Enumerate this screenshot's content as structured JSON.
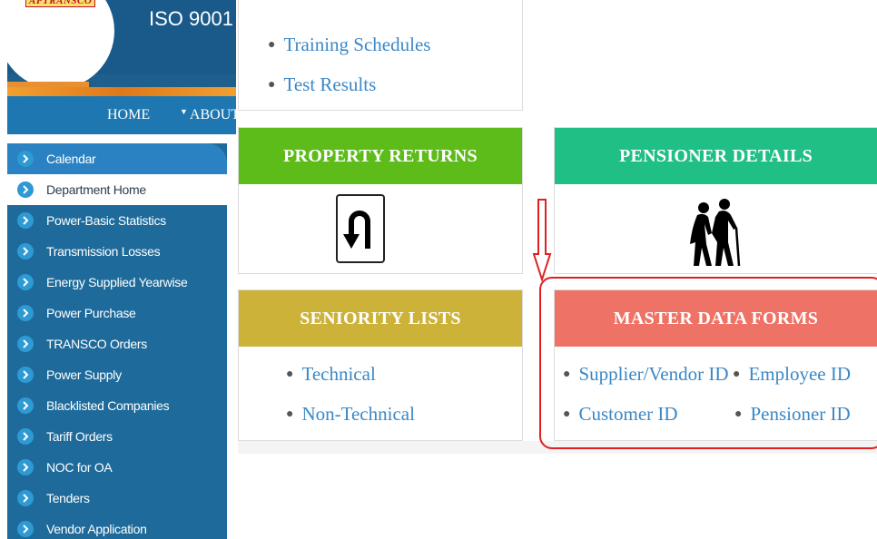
{
  "header": {
    "logo_text": "APTRANSCO",
    "iso_text": "ISO 9001"
  },
  "nav": {
    "home": "HOME",
    "about": "ABOUT"
  },
  "sidebar": {
    "items": [
      {
        "label": "Calendar",
        "state": "highlighted"
      },
      {
        "label": "Department Home",
        "state": "active"
      },
      {
        "label": "Power-Basic Statistics"
      },
      {
        "label": "Transmission Losses"
      },
      {
        "label": "Energy Supplied Yearwise"
      },
      {
        "label": "Power Purchase"
      },
      {
        "label": "TRANSCO Orders"
      },
      {
        "label": "Power Supply"
      },
      {
        "label": "Blacklisted Companies"
      },
      {
        "label": "Tariff Orders"
      },
      {
        "label": "NOC for OA"
      },
      {
        "label": "Tenders"
      },
      {
        "label": "Vendor Application"
      }
    ]
  },
  "cards": {
    "top": {
      "links": [
        "Training Schedules",
        "Test Results"
      ]
    },
    "property_returns": {
      "title": "PROPERTY RETURNS",
      "icon": "u-turn-sign-icon",
      "color": "#5dbb1a"
    },
    "seniority_lists": {
      "title": "SENIORITY LISTS",
      "links": [
        "Technical",
        "Non-Technical"
      ],
      "color": "#cdb23a"
    },
    "pensioner_details": {
      "title": "PENSIONER DETAILS",
      "icon": "elderly-couple-icon",
      "color": "#20bf86"
    },
    "master_data_forms": {
      "title": "MASTER DATA FORMS",
      "links": [
        "Supplier/Vendor ID",
        "Employee ID",
        "Customer ID",
        "Pensioner ID"
      ],
      "color": "#ee7366"
    }
  },
  "colors": {
    "sidebar_bg": "#1e6b9b",
    "navbar_bg": "#1e77b0",
    "link": "#3b88c6",
    "annotation": "#e02020"
  }
}
